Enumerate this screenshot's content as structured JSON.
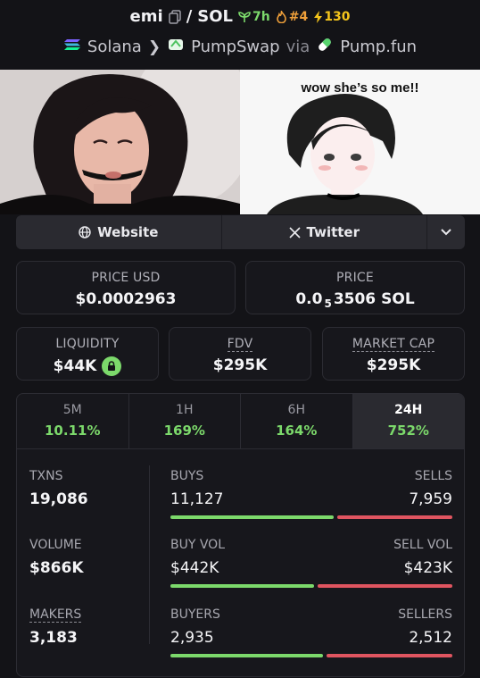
{
  "header": {
    "token_name": "emi",
    "slash": "/",
    "quote": "SOL",
    "age": "7h",
    "rank": "#4",
    "boosts": "130",
    "chain": "Solana",
    "dex": "PumpSwap",
    "via_label": "via",
    "launchpad": "Pump.fun"
  },
  "banner": {
    "caption": "wow she’s so me!!"
  },
  "links": {
    "website": "Website",
    "twitter": "Twitter"
  },
  "price": {
    "usd_label": "PRICE USD",
    "usd_value": "$0.0002963",
    "native_label": "PRICE",
    "native_prefix": "0.0",
    "native_zeros": "5",
    "native_digits": "3506",
    "native_unit": "SOL"
  },
  "metrics": {
    "liquidity_label": "LIQUIDITY",
    "liquidity_value": "$44K",
    "fdv_label": "FDV",
    "fdv_value": "$295K",
    "mcap_label": "MARKET CAP",
    "mcap_value": "$295K"
  },
  "timeframes": [
    {
      "label": "5M",
      "value": "10.11%"
    },
    {
      "label": "1H",
      "value": "169%"
    },
    {
      "label": "6H",
      "value": "164%"
    },
    {
      "label": "24H",
      "value": "752%",
      "active": true
    }
  ],
  "stats": {
    "txns_label": "TXNS",
    "txns_value": "19,086",
    "buys_label": "BUYS",
    "buys_value": "11,127",
    "sells_label": "SELLS",
    "sells_value": "7,959",
    "buys_ratio": 0.58,
    "volume_label": "VOLUME",
    "volume_value": "$866K",
    "buyvol_label": "BUY VOL",
    "buyvol_value": "$442K",
    "sellvol_label": "SELL VOL",
    "sellvol_value": "$423K",
    "buyvol_ratio": 0.51,
    "makers_label": "MAKERS",
    "makers_value": "3,183",
    "buyers_label": "BUYERS",
    "buyers_value": "2,935",
    "sellers_label": "SELLERS",
    "sellers_value": "2,512",
    "buyers_ratio": 0.54
  },
  "colors": {
    "positive": "#7cd96b",
    "negative": "#e05560",
    "background": "#131317"
  }
}
